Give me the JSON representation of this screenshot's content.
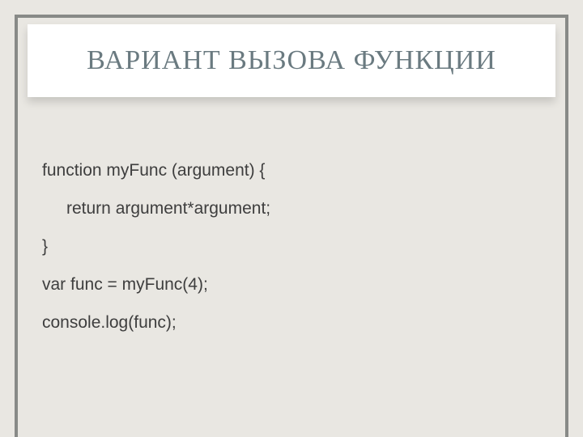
{
  "title": "ВАРИАНТ ВЫЗОВА ФУНКЦИИ",
  "code": {
    "line1": "function myFunc (argument) {",
    "line2": "return argument*argument;",
    "line3": "}",
    "line4": "var func = myFunc(4);",
    "line5": "console.log(func);"
  }
}
